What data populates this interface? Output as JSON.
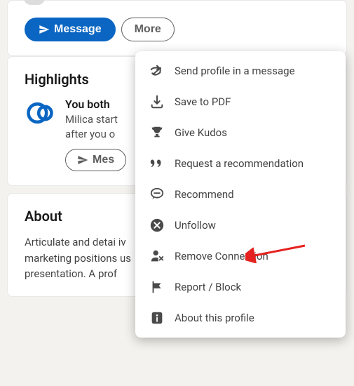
{
  "buttons": {
    "message_label": "Message",
    "more_label": "More"
  },
  "highlights": {
    "heading": "Highlights",
    "title": "You both",
    "subtitle_l1": "Milica start",
    "subtitle_l2": "after you o",
    "msg_button": "Mes"
  },
  "about": {
    "heading": "About",
    "text_line": "Articulate and detai                                                                     iv\nmarketing positions                                                                    us\npresentation. A prof"
  },
  "dropdown": {
    "send_profile": "Send profile in a message",
    "save_pdf": "Save to PDF",
    "give_kudos": "Give Kudos",
    "request_rec": "Request a recommendation",
    "recommend": "Recommend",
    "unfollow": "Unfollow",
    "remove_conn": "Remove Connection",
    "report": "Report / Block",
    "about_profile": "About this profile"
  }
}
